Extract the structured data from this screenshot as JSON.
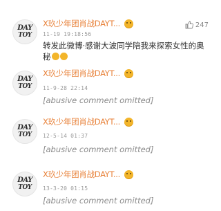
{
  "avatar": {
    "line1": "DAY",
    "line2": "TOY"
  },
  "like_count": "247",
  "colors": {
    "username": "#e8823a",
    "badge": "#f3b52a",
    "text": "#2b2b2b",
    "time": "#9a9a9a"
  },
  "comments": [
    {
      "username": "X玖少年团肖战DAYT...",
      "time": "11-19 19:18:56",
      "text": "转发此微博·感谢大波同学陪我来探索女性的奥秘"
    },
    {
      "username": "X玖少年团肖战DAYT...",
      "time": "11-9-28 22:14",
      "text": "[abusive comment omitted]"
    },
    {
      "username": "X玖少年团肖战DAYT...",
      "time": "12-5-14 01:37",
      "text": "[abusive comment omitted]"
    },
    {
      "username": "X玖少年团肖战DAYT...",
      "time": "13-3-20 01:15",
      "text": "[abusive comment omitted]"
    }
  ]
}
